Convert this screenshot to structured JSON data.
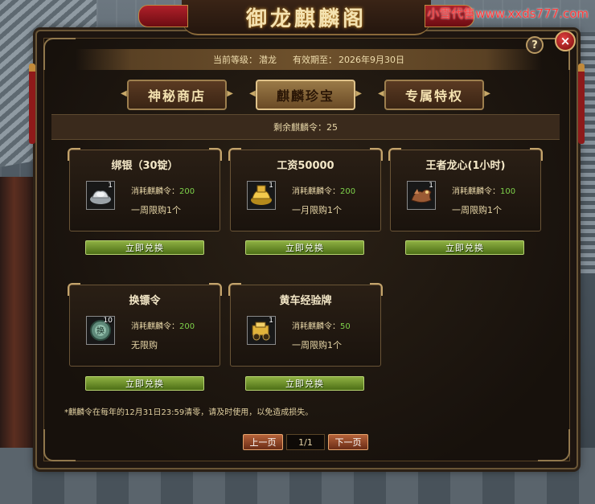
{
  "watermark": "小雪代售www.xxds777.com",
  "window": {
    "title": "御龙麒麟阁",
    "help_label": "?",
    "close_label": "×"
  },
  "info": {
    "level_label": "当前等级：",
    "level_value": "潜龙",
    "expiry_label": "有效期至：",
    "expiry_value": "2026年9月30日"
  },
  "tabs": [
    {
      "label": "神秘商店",
      "active": false
    },
    {
      "label": "麒麟珍宝",
      "active": true
    },
    {
      "label": "专属特权",
      "active": false
    }
  ],
  "tokens": {
    "label": "剩余麒麟令：",
    "value": "25"
  },
  "items": [
    {
      "name": "绑银（30锭）",
      "qty": "1",
      "cost_label": "消耗麒麟令：",
      "cost": "200",
      "limit": "一周限购1个",
      "button": "立即兑换",
      "icon": "silver-ingot-icon"
    },
    {
      "name": "工资50000",
      "qty": "1",
      "cost_label": "消耗麒麟令：",
      "cost": "200",
      "limit": "一月限购1个",
      "button": "立即兑换",
      "icon": "gold-ingot-icon"
    },
    {
      "name": "王者龙心(1小时)",
      "qty": "1",
      "cost_label": "消耗麒麟令：",
      "cost": "100",
      "limit": "一周限购1个",
      "button": "立即兑换",
      "icon": "dragon-heart-icon"
    },
    {
      "name": "换镖令",
      "qty": "10",
      "cost_label": "消耗麒麟令：",
      "cost": "200",
      "limit": "无限购",
      "button": "立即兑换",
      "icon": "escort-token-icon"
    },
    {
      "name": "黄车经验牌",
      "qty": "1",
      "cost_label": "消耗麒麟令：",
      "cost": "50",
      "limit": "一周限购1个",
      "button": "立即兑换",
      "icon": "gold-cart-icon"
    }
  ],
  "notice": "*麒麟令在每年的12月31日23:59清零，请及时使用，以免造成损失。",
  "pager": {
    "prev": "上一页",
    "page": "1/1",
    "next": "下一页"
  },
  "colors": {
    "accent_green": "#7ed24a",
    "button_green": "#6b8f28",
    "pager_red": "#a04a28",
    "title_gold": "#f4e2b0"
  }
}
